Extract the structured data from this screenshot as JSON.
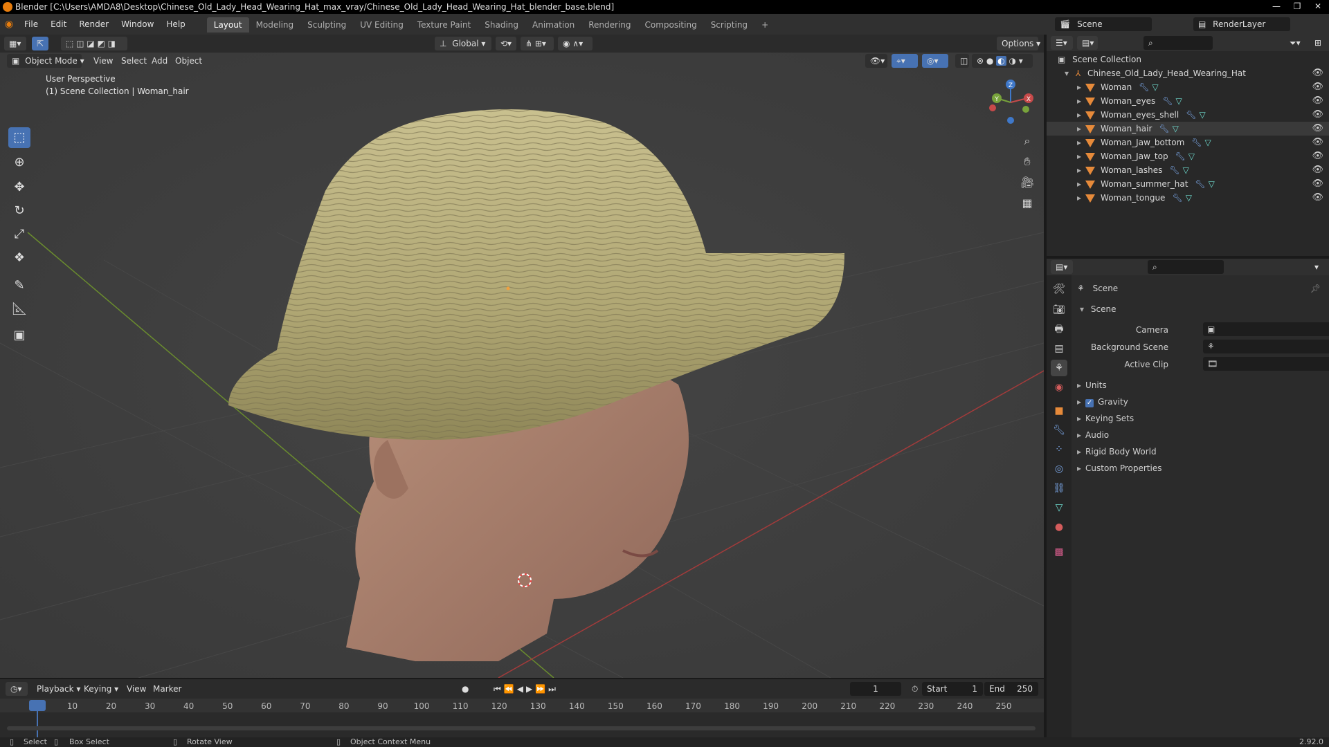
{
  "window": {
    "title": "Blender [C:\\Users\\AMDA8\\Desktop\\Chinese_Old_Lady_Head_Wearing_Hat_max_vray/Chinese_Old_Lady_Head_Wearing_Hat_blender_base.blend]",
    "min": "—",
    "max": "❐",
    "close": "✕"
  },
  "menu": {
    "items": [
      "File",
      "Edit",
      "Render",
      "Window",
      "Help"
    ]
  },
  "workspaces": [
    "Layout",
    "Modeling",
    "Sculpting",
    "UV Editing",
    "Texture Paint",
    "Shading",
    "Animation",
    "Rendering",
    "Compositing",
    "Scripting"
  ],
  "workspace_add": "+",
  "scene": {
    "name": "Scene",
    "render_layer": "RenderLayer"
  },
  "viewport": {
    "mode": "Object Mode",
    "menus": [
      "View",
      "Select",
      "Add",
      "Object"
    ],
    "transform_orientation": "Global",
    "options": "Options",
    "overlay_line1": "User Perspective",
    "overlay_line2": "(1) Scene Collection | Woman_hair",
    "gizmo": {
      "x": "X",
      "y": "Y",
      "z": "Z"
    }
  },
  "outliner": {
    "root": "Scene Collection",
    "collection": "Chinese_Old_Lady_Head_Wearing_Hat",
    "objects": [
      "Woman",
      "Woman_eyes",
      "Woman_eyes_shell",
      "Woman_hair",
      "Woman_Jaw_bottom",
      "Woman_Jaw_top",
      "Woman_lashes",
      "Woman_summer_hat",
      "Woman_tongue"
    ],
    "selected": "Woman_hair"
  },
  "properties": {
    "header": "Scene",
    "panel": "Scene",
    "fields": [
      {
        "label": "Camera",
        "value": ""
      },
      {
        "label": "Background Scene",
        "value": ""
      },
      {
        "label": "Active Clip",
        "value": ""
      }
    ],
    "sections": [
      "Units",
      "Gravity",
      "Keying Sets",
      "Audio",
      "Rigid Body World",
      "Custom Properties"
    ],
    "gravity_checked": true
  },
  "timeline": {
    "menus": [
      "Playback",
      "Keying",
      "View",
      "Marker"
    ],
    "current_frame": "1",
    "start_label": "Start",
    "start": "1",
    "end_label": "End",
    "end": "250",
    "ticks": [
      "1",
      "10",
      "20",
      "30",
      "40",
      "50",
      "60",
      "70",
      "80",
      "90",
      "100",
      "110",
      "120",
      "130",
      "140",
      "150",
      "160",
      "170",
      "180",
      "190",
      "200",
      "210",
      "220",
      "230",
      "240",
      "250"
    ]
  },
  "status": {
    "select": "Select",
    "box_select": "Box Select",
    "rotate_view": "Rotate View",
    "context_menu": "Object Context Menu",
    "version": "2.92.0"
  },
  "colors": {
    "accent": "#4772b3",
    "active_frame": "#4772b3",
    "mesh_icon": "#e68a3a",
    "x_axis": "#c74a4a",
    "y_axis": "#78a33b",
    "z_axis": "#3f78c9"
  }
}
